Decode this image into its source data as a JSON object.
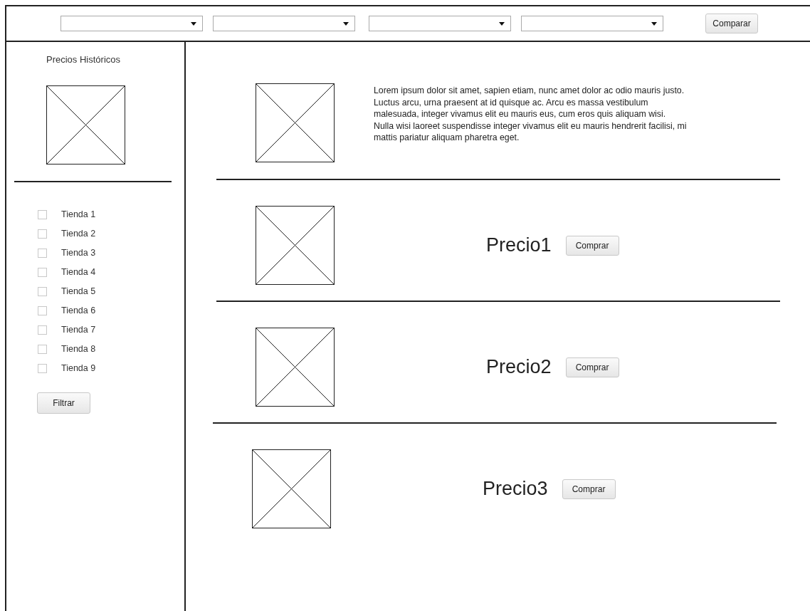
{
  "toolbar": {
    "dropdowns": [
      {
        "kind": "dropdown"
      },
      {
        "kind": "dropdown"
      },
      {
        "kind": "dropdown"
      },
      {
        "kind": "dropdown"
      }
    ],
    "compare_button": "Comparar"
  },
  "sidebar": {
    "title": "Precios Históricos",
    "stores": [
      {
        "label": "Tienda 1",
        "checked": false
      },
      {
        "label": "Tienda 2",
        "checked": false
      },
      {
        "label": "Tienda 3",
        "checked": false
      },
      {
        "label": "Tienda 4",
        "checked": false
      },
      {
        "label": "Tienda 5",
        "checked": false
      },
      {
        "label": "Tienda 6",
        "checked": false
      },
      {
        "label": "Tienda 7",
        "checked": false
      },
      {
        "label": "Tienda 8",
        "checked": false
      },
      {
        "label": "Tienda 9",
        "checked": false
      }
    ],
    "filter_button": "Filtrar"
  },
  "main": {
    "rows": [
      {
        "kind": "description",
        "text": "Lorem ipsum dolor sit amet, sapien etiam, nunc amet dolor ac odio mauris justo. Luctus arcu, urna praesent at id quisque ac. Arcu es massa vestibulum malesuada, integer vivamus elit eu mauris eus, cum eros quis aliquam wisi. Nulla wisi laoreet suspendisse integer vivamus elit eu mauris hendrerit facilisi, mi mattis pariatur aliquam pharetra eget."
      },
      {
        "kind": "offer",
        "price": "Precio1",
        "button": "Comprar"
      },
      {
        "kind": "offer",
        "price": "Precio2",
        "button": "Comprar"
      },
      {
        "kind": "offer",
        "price": "Precio3",
        "button": "Comprar"
      }
    ]
  }
}
